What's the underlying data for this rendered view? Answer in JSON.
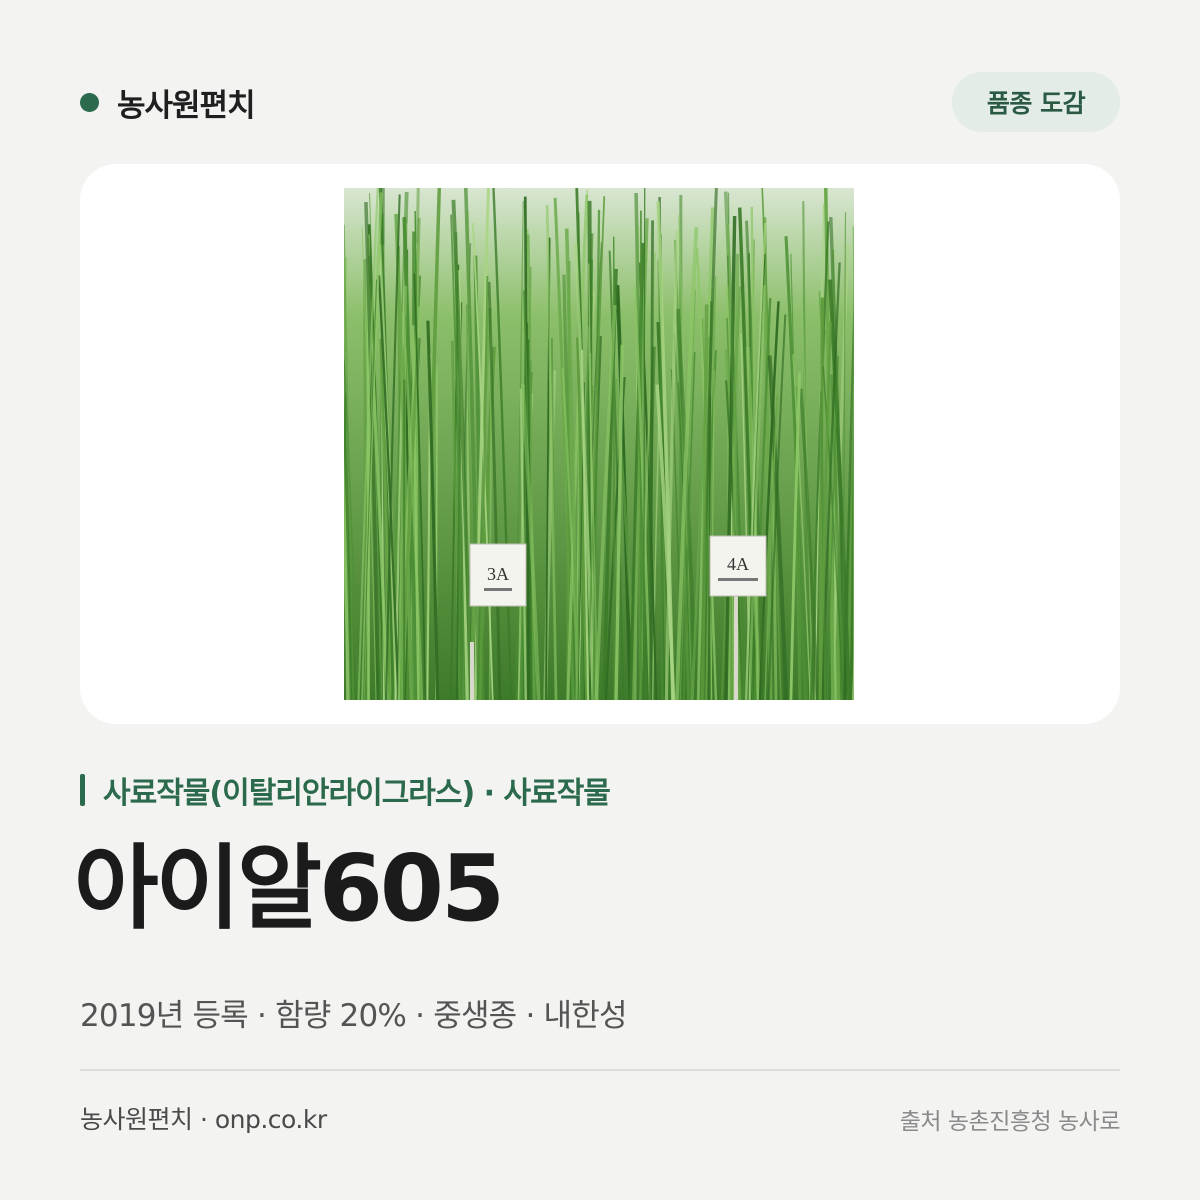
{
  "header": {
    "brand_name": "농사원편치",
    "tag_label": "품종 도감"
  },
  "photo": {
    "sign_left_label": "3A",
    "sign_right_label": "4A",
    "colors": {
      "grass_dark": "#3f7d2c",
      "grass_light": "#8fc762",
      "sign": "#f4f4ee"
    }
  },
  "variety": {
    "category": "사료작물(이탈리안라이그라스) · 사료작물",
    "name": "아이알605",
    "meta": "2019년 등록 · 함량 20% · 중생종 · 내한성"
  },
  "footer": {
    "left": "농사원편치 · onp.co.kr",
    "right": "출처 농촌진흥청 농사로"
  },
  "colors": {
    "accent": "#2b6a4d",
    "pill_bg": "#e3ece6",
    "background": "#f3f3f1"
  }
}
